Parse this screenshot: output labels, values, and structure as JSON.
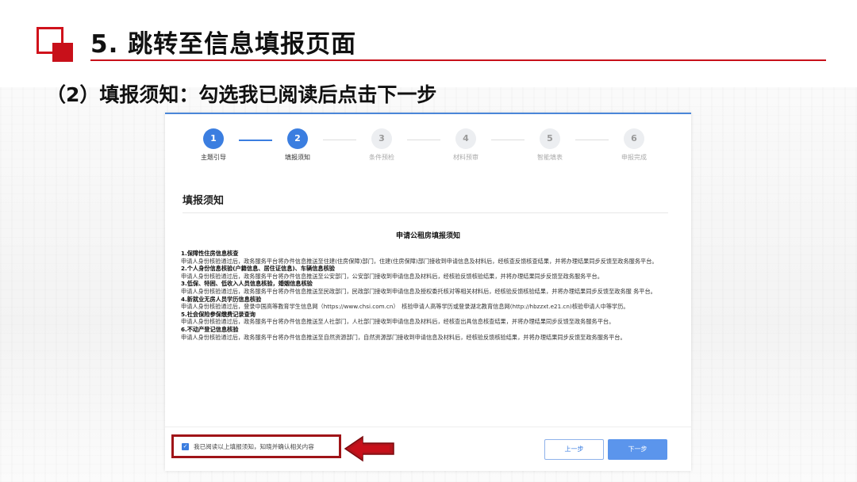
{
  "slide": {
    "title": "5. 跳转至信息填报页面",
    "subtitle": "（2）填报须知：勾选我已阅读后点击下一步"
  },
  "stepper": {
    "steps": [
      {
        "num": "1",
        "label": "主题引导",
        "state": "active"
      },
      {
        "num": "2",
        "label": "填报须知",
        "state": "active"
      },
      {
        "num": "3",
        "label": "条件预检",
        "state": "idle"
      },
      {
        "num": "4",
        "label": "材料预审",
        "state": "idle"
      },
      {
        "num": "5",
        "label": "智能填表",
        "state": "idle"
      },
      {
        "num": "6",
        "label": "申报完成",
        "state": "idle"
      }
    ]
  },
  "notice": {
    "heading": "填报须知",
    "doc_title": "申请公租房填报须知",
    "items": [
      {
        "title": "1.保障性住房信息核查",
        "text": "申请人身份核验通过后，政务服务平台将办件信息推送至住建(住房保障)部门，住建(住房保障)部门接收到申请信息及材料后，经核查反馈核查结果，并将办理结果同步反馈至政务服务平台。"
      },
      {
        "title": "2.个人身份信息核验(户籍信息、居住证信息)、车辆信息核验",
        "text": "申请人身份核验通过后，政务服务平台将办件信息推送至公安部门，公安部门接收到申请信息及材料后，经核验反馈核验结果，并将办理结果同步反馈至政务服务平台。"
      },
      {
        "title": "3.低保、特困、低收入人员信息核验，婚姻信息核验",
        "text": "申请人身份核验通过后，政务服务平台将办件信息推送至民政部门，民政部门接收到申请信息及授权委托核对等相关材料后，经核验反馈核验结果，并将办理结果同步反馈至政务服 务平台。"
      },
      {
        "title": "4.新就业无房人员学历信息核验",
        "text": "申请人身份核验通过后，登录中国高等教育学生信息网（https://www.chsi.com.cn）　核验申请人高等学历或登录湖北教育信息网(http://hbzzxt.e21.cn)核验申请人中等学历。"
      },
      {
        "title": "5.社会保险参保缴费记录查询",
        "text": "申请人身份核验通过后，政务服务平台将办件信息推送至人社部门，人社部门接收到申请信息及材料后，经核查出具信息核查结果，并将办理结果同步反馈至政务服务平台。"
      },
      {
        "title": "6.不动产登记信息核验",
        "text": "申请人身份核验通过后，政务服务平台将办件信息推送至自然资源部门，自然资源部门接收到申请信息及材料后，经核验反馈核验结果，并将办理结果同步反馈至政务服务平台。"
      }
    ]
  },
  "footer": {
    "agree_label": "我已阅读以上填报须知，知晓并确认相关内容",
    "agree_checked": true,
    "prev_label": "上一步",
    "next_label": "下一步"
  },
  "colors": {
    "accent_red": "#c8101a",
    "primary_blue": "#3b7ee0",
    "highlight_box": "#a01418"
  }
}
